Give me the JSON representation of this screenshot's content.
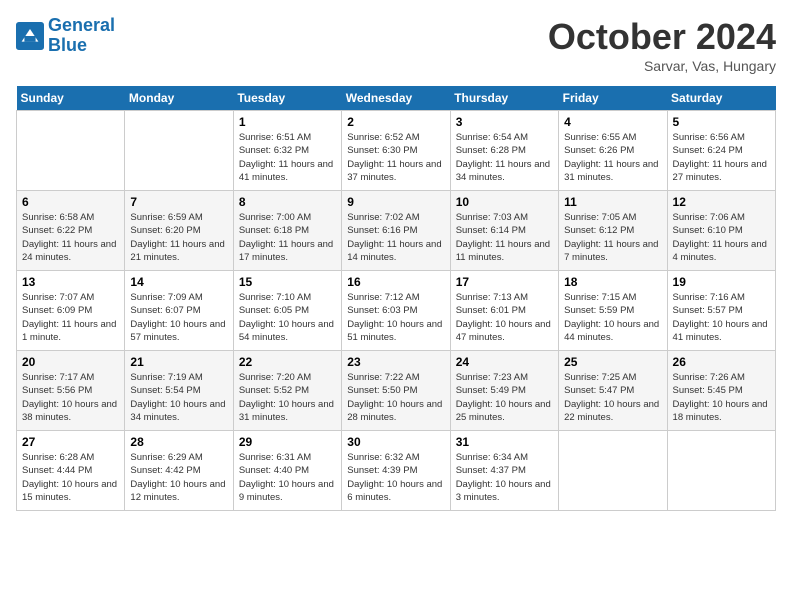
{
  "header": {
    "logo_line1": "General",
    "logo_line2": "Blue",
    "month": "October 2024",
    "location": "Sarvar, Vas, Hungary"
  },
  "weekdays": [
    "Sunday",
    "Monday",
    "Tuesday",
    "Wednesday",
    "Thursday",
    "Friday",
    "Saturday"
  ],
  "weeks": [
    [
      {
        "day": "",
        "info": ""
      },
      {
        "day": "",
        "info": ""
      },
      {
        "day": "1",
        "info": "Sunrise: 6:51 AM\nSunset: 6:32 PM\nDaylight: 11 hours and 41 minutes."
      },
      {
        "day": "2",
        "info": "Sunrise: 6:52 AM\nSunset: 6:30 PM\nDaylight: 11 hours and 37 minutes."
      },
      {
        "day": "3",
        "info": "Sunrise: 6:54 AM\nSunset: 6:28 PM\nDaylight: 11 hours and 34 minutes."
      },
      {
        "day": "4",
        "info": "Sunrise: 6:55 AM\nSunset: 6:26 PM\nDaylight: 11 hours and 31 minutes."
      },
      {
        "day": "5",
        "info": "Sunrise: 6:56 AM\nSunset: 6:24 PM\nDaylight: 11 hours and 27 minutes."
      }
    ],
    [
      {
        "day": "6",
        "info": "Sunrise: 6:58 AM\nSunset: 6:22 PM\nDaylight: 11 hours and 24 minutes."
      },
      {
        "day": "7",
        "info": "Sunrise: 6:59 AM\nSunset: 6:20 PM\nDaylight: 11 hours and 21 minutes."
      },
      {
        "day": "8",
        "info": "Sunrise: 7:00 AM\nSunset: 6:18 PM\nDaylight: 11 hours and 17 minutes."
      },
      {
        "day": "9",
        "info": "Sunrise: 7:02 AM\nSunset: 6:16 PM\nDaylight: 11 hours and 14 minutes."
      },
      {
        "day": "10",
        "info": "Sunrise: 7:03 AM\nSunset: 6:14 PM\nDaylight: 11 hours and 11 minutes."
      },
      {
        "day": "11",
        "info": "Sunrise: 7:05 AM\nSunset: 6:12 PM\nDaylight: 11 hours and 7 minutes."
      },
      {
        "day": "12",
        "info": "Sunrise: 7:06 AM\nSunset: 6:10 PM\nDaylight: 11 hours and 4 minutes."
      }
    ],
    [
      {
        "day": "13",
        "info": "Sunrise: 7:07 AM\nSunset: 6:09 PM\nDaylight: 11 hours and 1 minute."
      },
      {
        "day": "14",
        "info": "Sunrise: 7:09 AM\nSunset: 6:07 PM\nDaylight: 10 hours and 57 minutes."
      },
      {
        "day": "15",
        "info": "Sunrise: 7:10 AM\nSunset: 6:05 PM\nDaylight: 10 hours and 54 minutes."
      },
      {
        "day": "16",
        "info": "Sunrise: 7:12 AM\nSunset: 6:03 PM\nDaylight: 10 hours and 51 minutes."
      },
      {
        "day": "17",
        "info": "Sunrise: 7:13 AM\nSunset: 6:01 PM\nDaylight: 10 hours and 47 minutes."
      },
      {
        "day": "18",
        "info": "Sunrise: 7:15 AM\nSunset: 5:59 PM\nDaylight: 10 hours and 44 minutes."
      },
      {
        "day": "19",
        "info": "Sunrise: 7:16 AM\nSunset: 5:57 PM\nDaylight: 10 hours and 41 minutes."
      }
    ],
    [
      {
        "day": "20",
        "info": "Sunrise: 7:17 AM\nSunset: 5:56 PM\nDaylight: 10 hours and 38 minutes."
      },
      {
        "day": "21",
        "info": "Sunrise: 7:19 AM\nSunset: 5:54 PM\nDaylight: 10 hours and 34 minutes."
      },
      {
        "day": "22",
        "info": "Sunrise: 7:20 AM\nSunset: 5:52 PM\nDaylight: 10 hours and 31 minutes."
      },
      {
        "day": "23",
        "info": "Sunrise: 7:22 AM\nSunset: 5:50 PM\nDaylight: 10 hours and 28 minutes."
      },
      {
        "day": "24",
        "info": "Sunrise: 7:23 AM\nSunset: 5:49 PM\nDaylight: 10 hours and 25 minutes."
      },
      {
        "day": "25",
        "info": "Sunrise: 7:25 AM\nSunset: 5:47 PM\nDaylight: 10 hours and 22 minutes."
      },
      {
        "day": "26",
        "info": "Sunrise: 7:26 AM\nSunset: 5:45 PM\nDaylight: 10 hours and 18 minutes."
      }
    ],
    [
      {
        "day": "27",
        "info": "Sunrise: 6:28 AM\nSunset: 4:44 PM\nDaylight: 10 hours and 15 minutes."
      },
      {
        "day": "28",
        "info": "Sunrise: 6:29 AM\nSunset: 4:42 PM\nDaylight: 10 hours and 12 minutes."
      },
      {
        "day": "29",
        "info": "Sunrise: 6:31 AM\nSunset: 4:40 PM\nDaylight: 10 hours and 9 minutes."
      },
      {
        "day": "30",
        "info": "Sunrise: 6:32 AM\nSunset: 4:39 PM\nDaylight: 10 hours and 6 minutes."
      },
      {
        "day": "31",
        "info": "Sunrise: 6:34 AM\nSunset: 4:37 PM\nDaylight: 10 hours and 3 minutes."
      },
      {
        "day": "",
        "info": ""
      },
      {
        "day": "",
        "info": ""
      }
    ]
  ]
}
